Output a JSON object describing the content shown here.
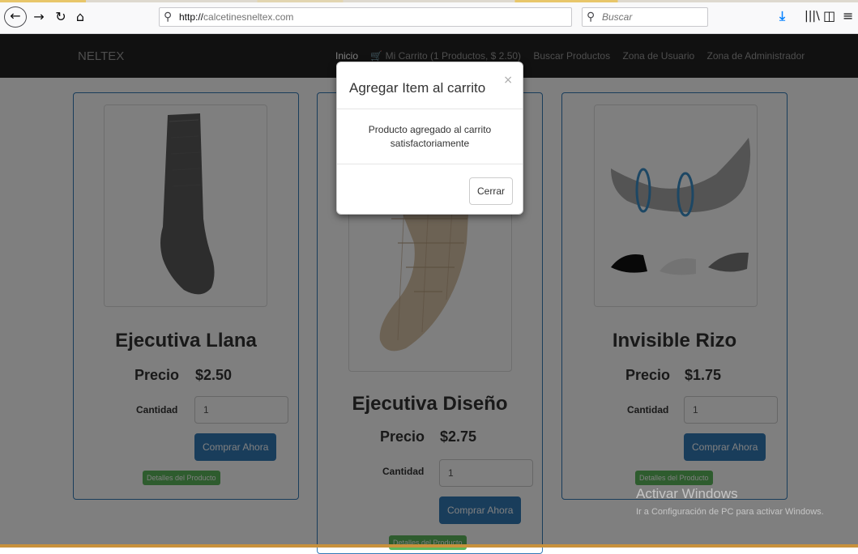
{
  "browser": {
    "url_scheme": "http://",
    "url_host": "calcetinesneltex.com",
    "search_placeholder": "Buscar",
    "icons": [
      "back-icon",
      "forward-icon",
      "reload-icon",
      "home-icon",
      "download-icon",
      "library-icon",
      "sidebar-icon",
      "menu-icon"
    ]
  },
  "navbar": {
    "brand": "NELTEX",
    "links": [
      "Inicio",
      "🛒 Mi Carrito (1 Productos, $ 2.50)",
      "Buscar Productos",
      "Zona de Usuario",
      "Zona de Administrador"
    ]
  },
  "products": [
    {
      "name": "Ejecutiva Llana",
      "price_label": "Precio",
      "price": "$2.50",
      "qty_label": "Cantidad",
      "qty": "1",
      "buy_label": "Comprar Ahora",
      "details_label": "Detalles del Producto"
    },
    {
      "name": "Ejecutiva Diseño",
      "price_label": "Precio",
      "price": "$2.75",
      "qty_label": "Cantidad",
      "qty": "1",
      "buy_label": "Comprar Ahora",
      "details_label": "Detalles del Producto"
    },
    {
      "name": "Invisible Rizo",
      "price_label": "Precio",
      "price": "$1.75",
      "qty_label": "Cantidad",
      "qty": "1",
      "buy_label": "Comprar Ahora",
      "details_label": "Detalles del Producto"
    }
  ],
  "modal": {
    "title": "Agregar Item al carrito",
    "close": "×",
    "body": "Producto agregado al carrito satisfactoriamente",
    "button": "Cerrar"
  },
  "watermark": {
    "line1": "Activar Windows",
    "line2": "Ir a Configuración de PC para activar Windows."
  },
  "colors": {
    "navbar_bg": "#222222",
    "primary": "#337ab7",
    "success": "#5cb85c",
    "overlay": "rgba(0,0,0,0.5)"
  }
}
